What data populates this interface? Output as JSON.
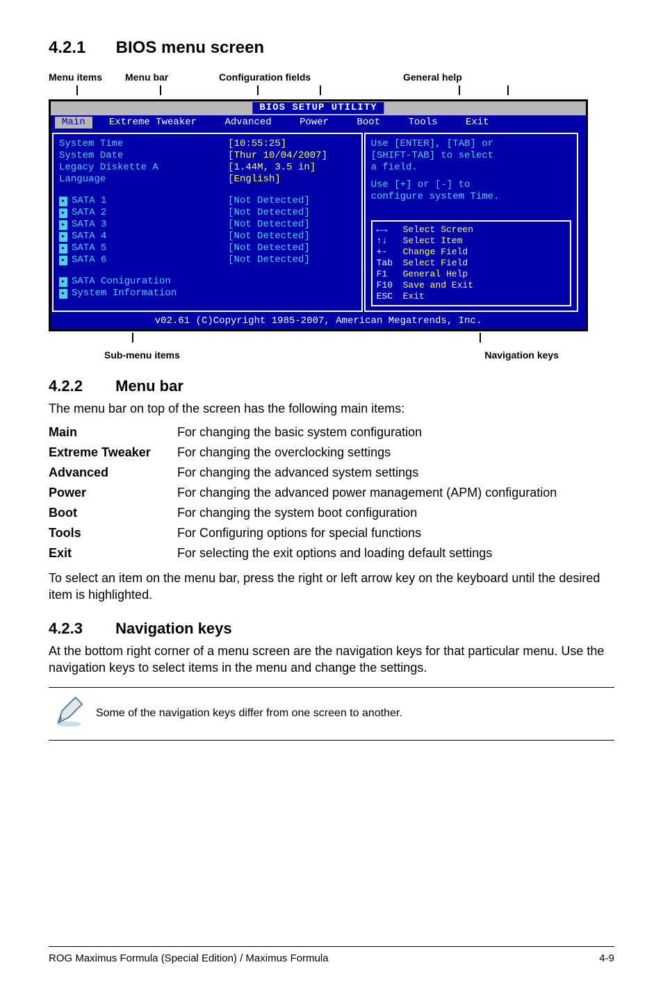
{
  "headings": {
    "s421_num": "4.2.1",
    "s421_title": "BIOS menu screen",
    "s422_num": "4.2.2",
    "s422_title": "Menu bar",
    "s423_num": "4.2.3",
    "s423_title": "Navigation keys"
  },
  "callouts": {
    "menu_items": "Menu items",
    "menu_bar": "Menu bar",
    "config_fields": "Configuration fields",
    "general_help": "General help",
    "sub_menu_items": "Sub-menu items",
    "navigation_keys": "Navigation keys"
  },
  "bios": {
    "title": "BIOS SETUP UTILITY",
    "menu": [
      "Main",
      "Extreme Tweaker",
      "Advanced",
      "Power",
      "Boot",
      "Tools",
      "Exit"
    ],
    "fields": {
      "system_time": {
        "label": "System Time",
        "value": "[10:55:25]"
      },
      "system_date": {
        "label": "System Date",
        "value": "[Thur 10/04/2007]"
      },
      "legacy_diskette": {
        "label": "Legacy Diskette A",
        "value": "[1.44M, 3.5 in]"
      },
      "language": {
        "label": "Language",
        "value": "[English]"
      },
      "sata1": {
        "label": "SATA 1",
        "value": "[Not Detected]"
      },
      "sata2": {
        "label": "SATA 2",
        "value": "[Not Detected]"
      },
      "sata3": {
        "label": "SATA 3",
        "value": "[Not Detected]"
      },
      "sata4": {
        "label": "SATA 4",
        "value": "[Not Detected]"
      },
      "sata5": {
        "label": "SATA 5",
        "value": "[Not Detected]"
      },
      "sata6": {
        "label": "SATA 6",
        "value": "[Not Detected]"
      },
      "sata_config": {
        "label": "SATA Coniguration"
      },
      "sys_info": {
        "label": "System Information"
      }
    },
    "help": {
      "line1": "Use [ENTER], [TAB] or",
      "line2": "[SHIFT-TAB] to select",
      "line3": "a field.",
      "line4": "Use [+] or [-] to",
      "line5": "configure system Time."
    },
    "navkeys": [
      {
        "k": "←→",
        "d": "Select Screen"
      },
      {
        "k": "↑↓",
        "d": "Select Item"
      },
      {
        "k": "+-",
        "d": "Change Field"
      },
      {
        "k": "Tab",
        "d": "Select Field"
      },
      {
        "k": "F1",
        "d": "General Help"
      },
      {
        "k": "F10",
        "d": "Save and Exit"
      },
      {
        "k": "ESC",
        "d": "Exit"
      }
    ],
    "footer": "v02.61 (C)Copyright 1985-2007, American Megatrends, Inc."
  },
  "s422_intro": "The menu bar on top of the screen has the following main items:",
  "def": {
    "main": {
      "lab": "Main",
      "desc": "For changing the basic system configuration"
    },
    "extremetweaker": {
      "lab": "Extreme Tweaker",
      "desc": "For changing the overclocking settings"
    },
    "advanced": {
      "lab": "Advanced",
      "desc": "For changing the advanced system settings"
    },
    "power": {
      "lab": "Power",
      "desc": "For changing the advanced power management (APM) configuration"
    },
    "boot": {
      "lab": "Boot",
      "desc": "For changing the system boot configuration"
    },
    "tools": {
      "lab": "Tools",
      "desc": "For Configuring options for special functions"
    },
    "exit": {
      "lab": "Exit",
      "desc": "For selecting the exit options and loading default settings"
    }
  },
  "s422_outro": "To select an item on the menu bar, press the right or left arrow key on the keyboard until the desired item is highlighted.",
  "s423_body": "At the bottom right corner of a menu screen are the navigation keys for that particular menu. Use the navigation keys to select items in the menu and change the settings.",
  "note": "Some of the navigation keys differ from one screen to another.",
  "footer_left": "ROG Maximus Formula (Special Edition) / Maximus Formula",
  "footer_right": "4-9"
}
